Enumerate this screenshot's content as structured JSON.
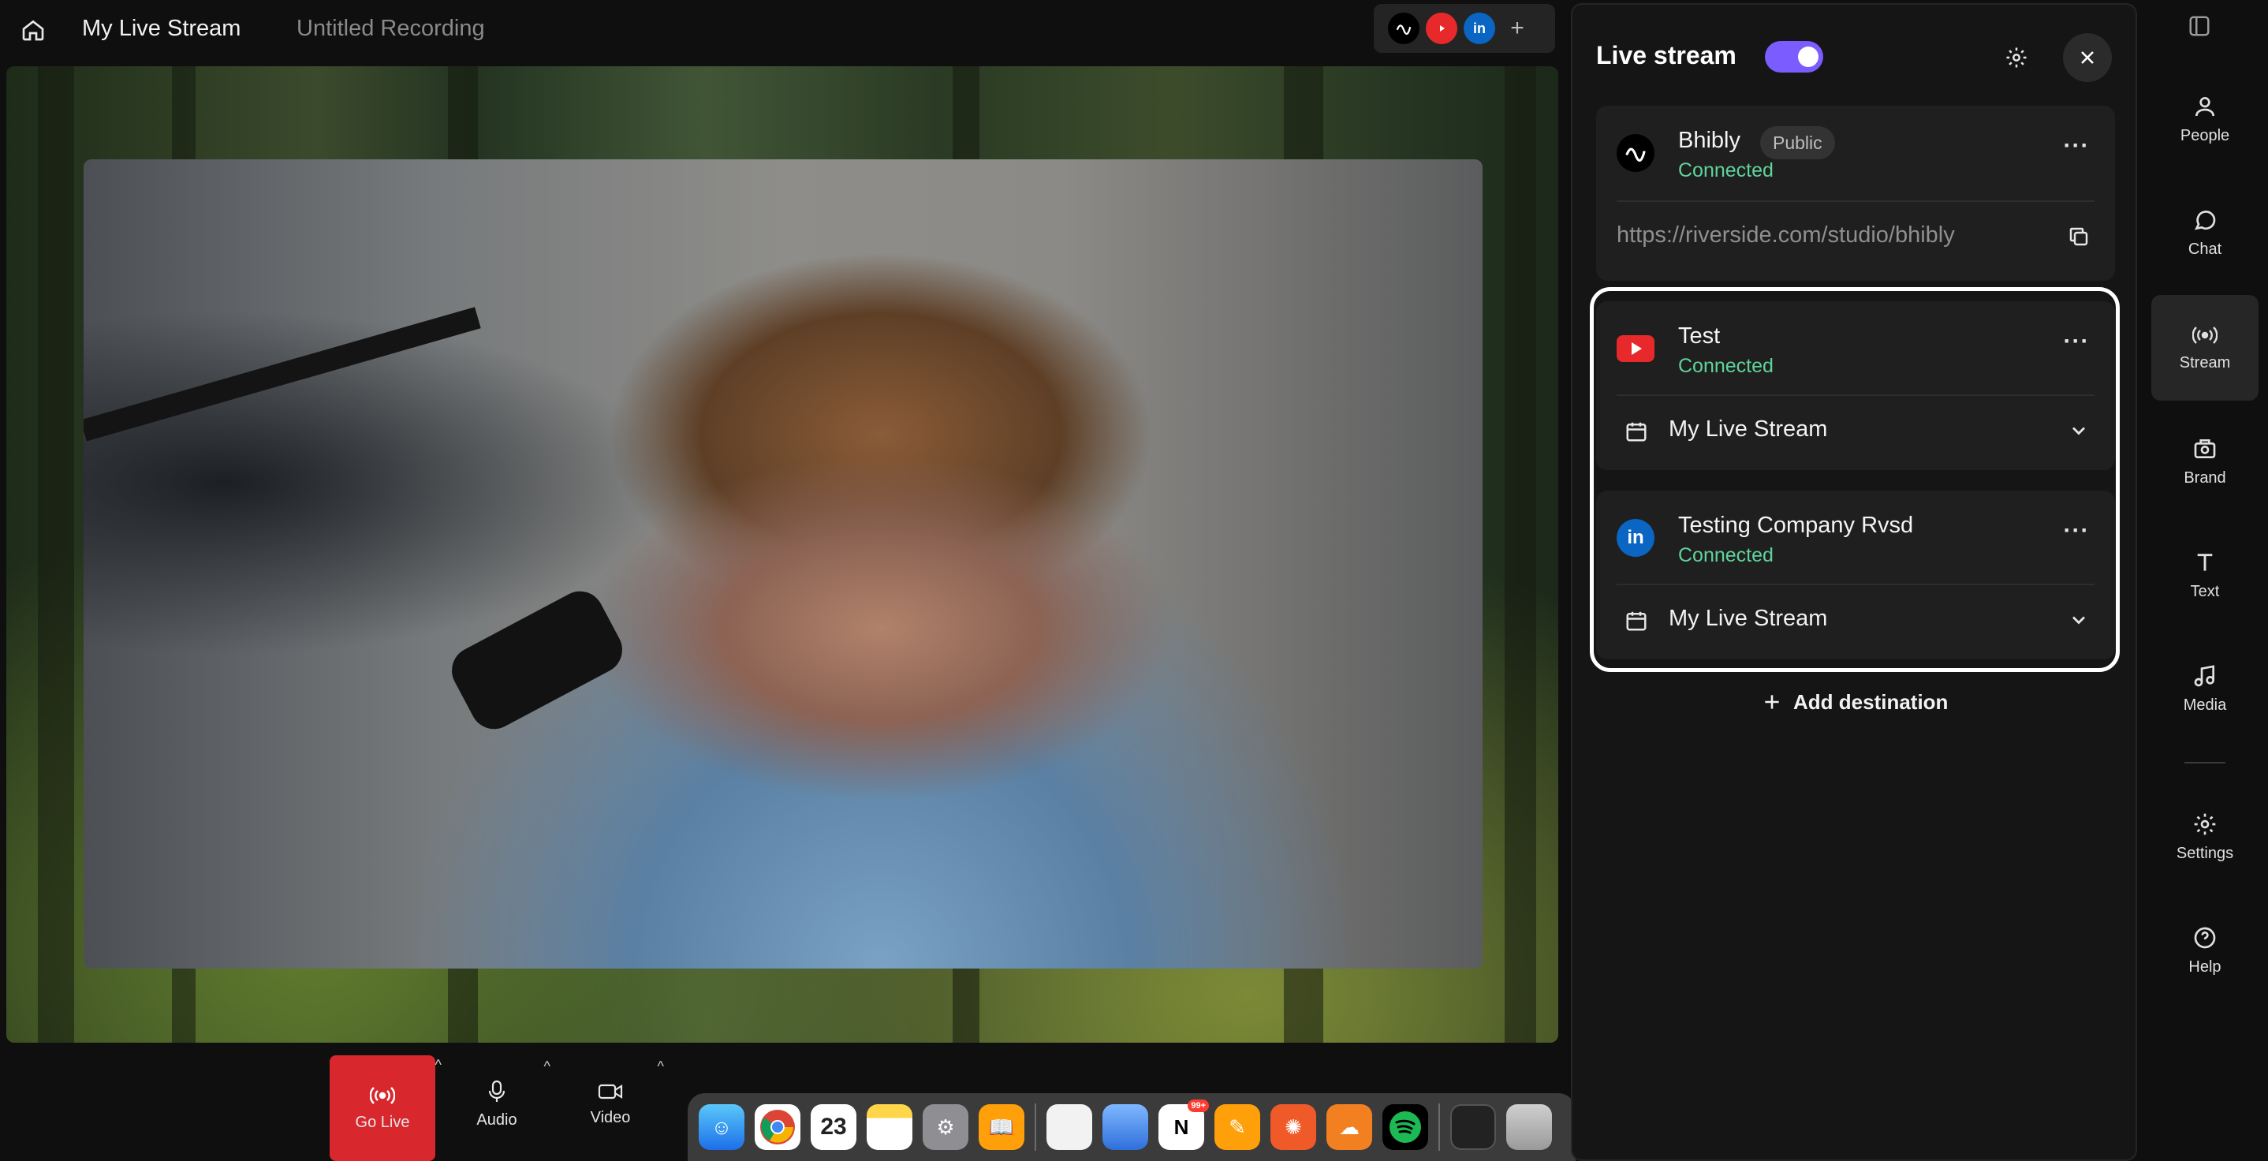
{
  "header": {
    "title": "My Live Stream",
    "recording_title": "Untitled Recording",
    "destinations_preview": [
      "riverside-icon",
      "youtube-icon",
      "linkedin-icon",
      "add-icon"
    ]
  },
  "controls": {
    "go_live": "Go Live",
    "audio": "Audio",
    "video": "Video"
  },
  "panel": {
    "title": "Live stream",
    "toggle_on": true,
    "accent_color": "#7b5cff",
    "destinations": [
      {
        "name": "Bhibly",
        "badge": "Public",
        "status": "Connected",
        "url": "https://riverside.com/studio/bhibly",
        "icon": "riverside-icon"
      },
      {
        "name": "Test",
        "status": "Connected",
        "event": "My Live Stream",
        "icon": "youtube-icon"
      },
      {
        "name": "Testing Company Rvsd",
        "status": "Connected",
        "event": "My Live Stream",
        "icon": "linkedin-icon"
      }
    ],
    "add_destination": "Add destination"
  },
  "sidebar": {
    "items": [
      {
        "label": "People",
        "icon": "people-icon"
      },
      {
        "label": "Chat",
        "icon": "chat-icon"
      },
      {
        "label": "Stream",
        "icon": "stream-icon",
        "active": true
      },
      {
        "label": "Brand",
        "icon": "brand-icon"
      },
      {
        "label": "Text",
        "icon": "text-icon"
      },
      {
        "label": "Media",
        "icon": "music-note-icon"
      },
      {
        "label": "Settings",
        "icon": "gear-icon"
      },
      {
        "label": "Help",
        "icon": "help-icon"
      }
    ]
  },
  "dock": {
    "calendar_date": "23",
    "notion_badge": "99+"
  },
  "colors": {
    "connected": "#5fd39a",
    "go_live": "#d9272e",
    "youtube": "#e8292b",
    "linkedin": "#0a66c2"
  }
}
